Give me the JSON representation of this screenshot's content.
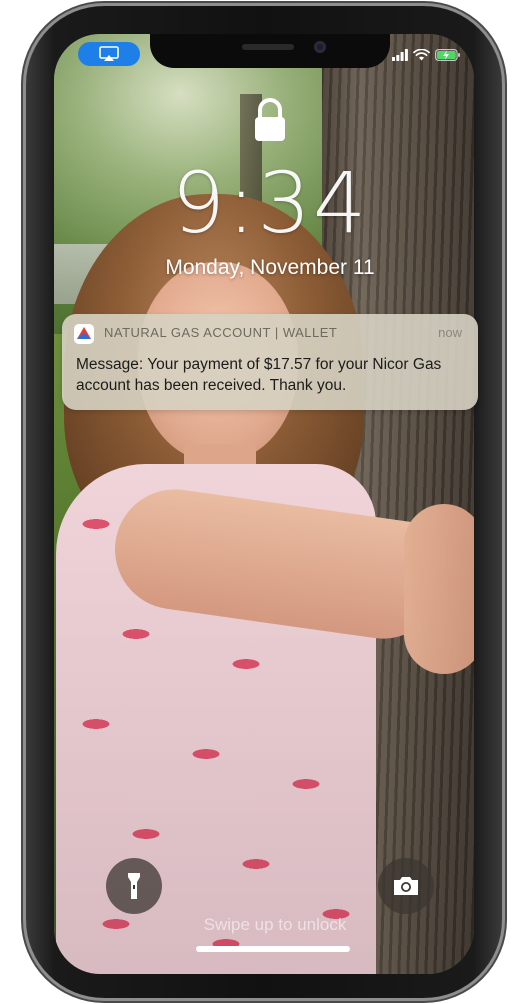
{
  "status_bar": {
    "airplay_icon": "airplay-icon",
    "signal_icon": "cellular-signal-icon",
    "wifi_icon": "wifi-icon",
    "battery_icon": "battery-charging-icon",
    "airplay_color": "#1f7fe8",
    "battery_color": "#4cd964"
  },
  "lock_screen": {
    "lock_icon": "padlock-icon",
    "time": "9:34",
    "date": "Monday, November 11"
  },
  "notification": {
    "app_name": "NATURAL GAS ACCOUNT | WALLET",
    "time": "now",
    "message": "Message: Your payment of $17.57 for your Nicor Gas account has been received. Thank you.",
    "app_icon": "wallet-app-icon"
  },
  "bottom": {
    "flashlight_icon": "flashlight-icon",
    "camera_icon": "camera-icon",
    "swipe_hint": "Swipe up to unlock"
  }
}
